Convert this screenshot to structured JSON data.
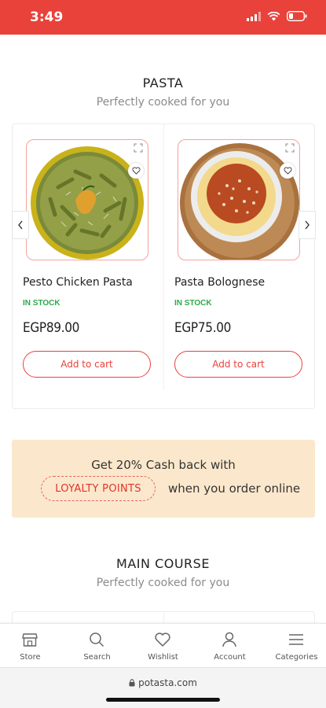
{
  "status_bar": {
    "time": "3:49",
    "icons": [
      "signal-icon",
      "wifi-icon",
      "battery-icon"
    ],
    "color": "#e8423a"
  },
  "pasta_section": {
    "title": "PASTA",
    "subtitle": "Perfectly cooked for you",
    "products": [
      {
        "name": "Pesto Chicken Pasta",
        "stock": "IN STOCK",
        "price": "EGP89.00",
        "cta": "Add to cart",
        "image": "pesto-pasta-image"
      },
      {
        "name": "Pasta Bolognese",
        "stock": "IN STOCK",
        "price": "EGP75.00",
        "cta": "Add to cart",
        "image": "bolognese-pasta-image"
      }
    ]
  },
  "loyalty_banner": {
    "line1": "Get 20% Cash back with",
    "pill": "LOYALTY POINTS",
    "line2": "when you order online",
    "background": "#fbe8cc"
  },
  "main_course_section": {
    "title": "MAIN COURSE",
    "subtitle": "Perfectly cooked for you"
  },
  "bottom_nav": {
    "items": [
      {
        "label": "Store",
        "icon": "store-icon"
      },
      {
        "label": "Search",
        "icon": "search-icon"
      },
      {
        "label": "Wishlist",
        "icon": "heart-icon"
      },
      {
        "label": "Account",
        "icon": "user-icon"
      },
      {
        "label": "Categories",
        "icon": "menu-icon"
      }
    ]
  },
  "browser": {
    "url": "potasta.com"
  },
  "colors": {
    "accent": "#e8423a",
    "stock": "#2ea84a"
  }
}
